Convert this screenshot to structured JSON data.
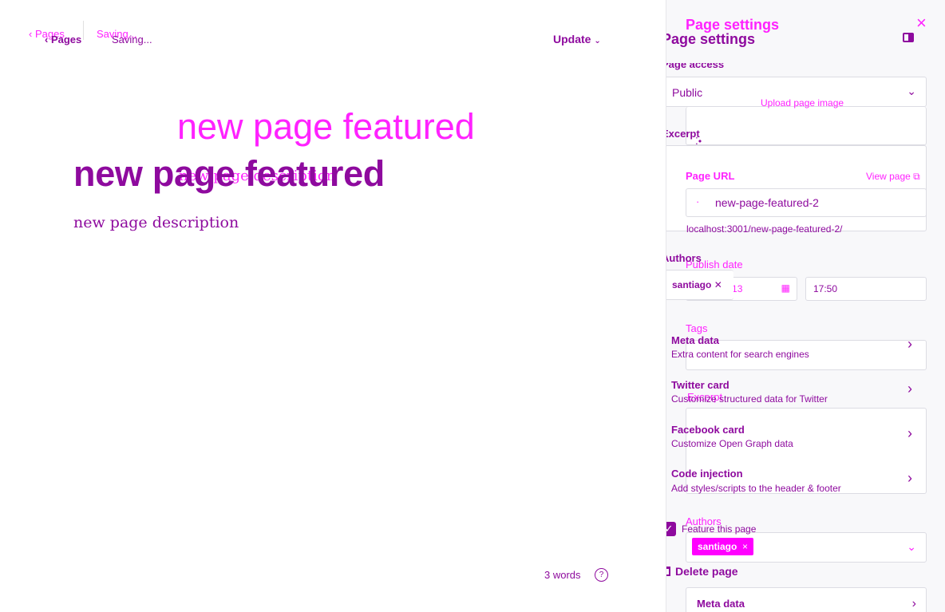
{
  "header": {
    "back_label": "Pages",
    "back_label_ghost": "Pages",
    "status": "Saving...",
    "status_ghost": "Saving...",
    "update_label": "Update"
  },
  "editor": {
    "title": "new page featured",
    "title_ghost": "new page featured",
    "description": "new page description",
    "description_ghost": "new page description",
    "word_count": "3 words",
    "help_icon": "?"
  },
  "panel": {
    "title": "Page settings",
    "title_ghost": "Page settings",
    "close_icon": "×",
    "page_access_label": "Page access",
    "page_access_value": "Public",
    "upload_image_label": "Upload page image",
    "excerpt_label": "Excerpt",
    "excerpt_label_ghost": "Excerpt",
    "page_url_label": "Page URL",
    "view_page_label": "View page",
    "page_url_value": "new-page-featured-2",
    "page_url_full": "localhost:3001/new-page-featured-2/",
    "publish_date_label": "Publish date",
    "publish_date": "2023-05-13",
    "publish_time": "17:50",
    "tags_label": "Tags",
    "authors_label": "Authors",
    "authors_label_ghost": "Authors",
    "author_name": "santiago",
    "author_name_ghost": "santiago",
    "accordion": [
      {
        "title": "Meta data",
        "subtitle": "Extra content for search engines"
      },
      {
        "title": "Twitter card",
        "subtitle": "Customize structured data for Twitter"
      },
      {
        "title": "Facebook card",
        "subtitle": "Customize Open Graph data"
      },
      {
        "title": "Code injection",
        "subtitle": "Add styles/scripts to the header & footer"
      }
    ],
    "feature_label": "Feature this page",
    "delete_label": "Delete page",
    "meta_data_ghost": "Meta data"
  },
  "colors": {
    "accent": "#8e0a9e",
    "ghost": "#ff00ff",
    "panel_bg": "#f8f8fa"
  }
}
